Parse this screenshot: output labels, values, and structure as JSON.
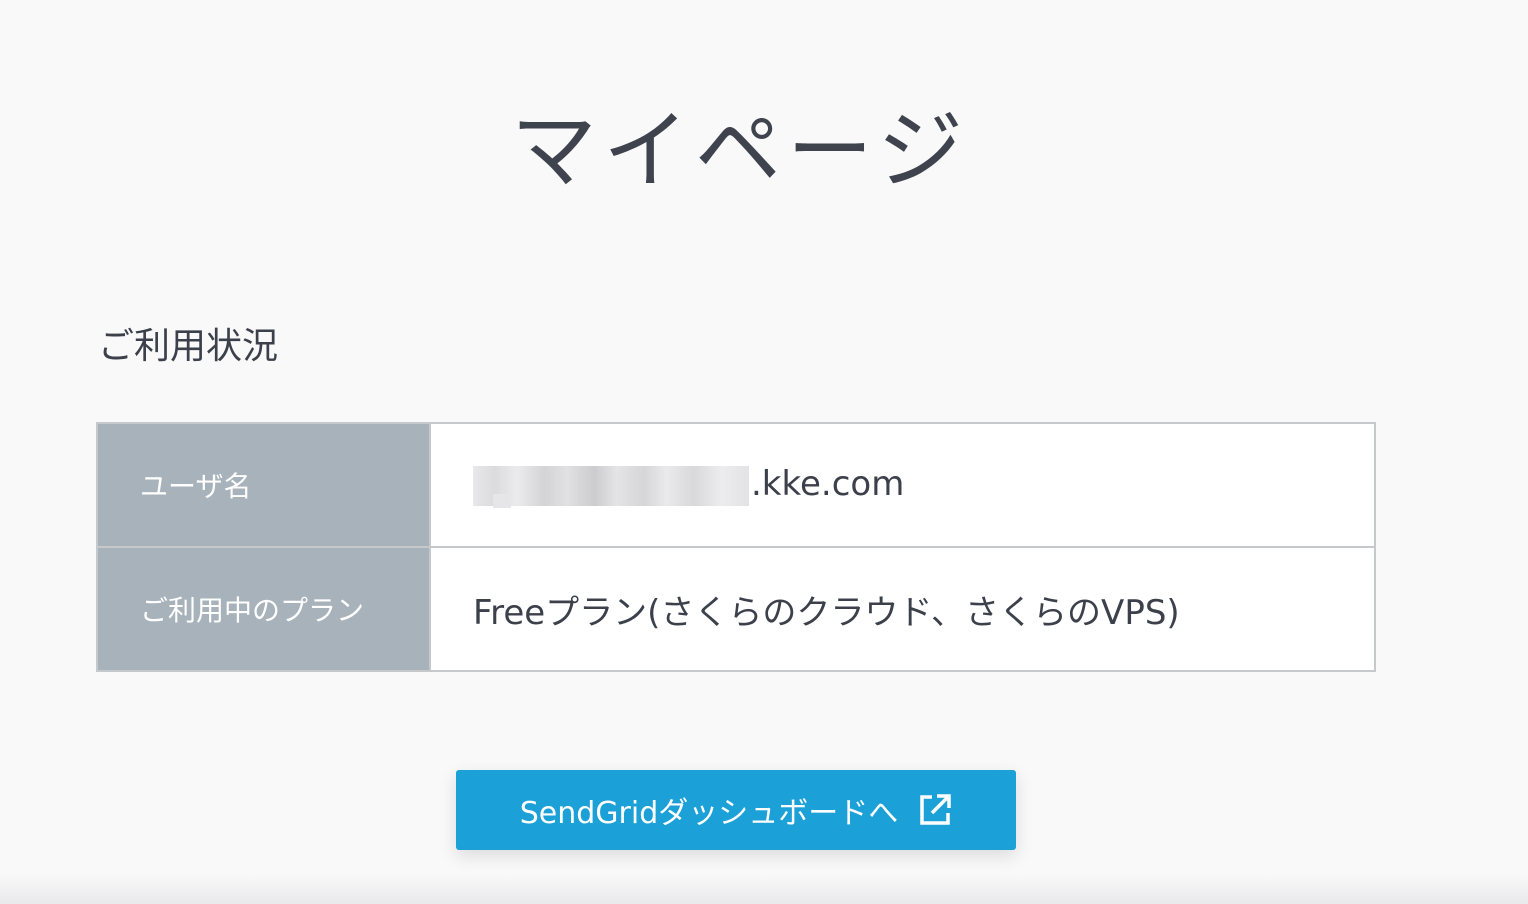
{
  "page": {
    "title": "マイページ"
  },
  "usage": {
    "section_title": "ご利用状況",
    "rows": [
      {
        "label": "ユーザ名",
        "value": ".kke.com"
      },
      {
        "label": "ご利用中のプラン",
        "value": "Freeプラン(さくらのクラウド、さくらのVPS)"
      }
    ]
  },
  "actions": {
    "dashboard_button_label": "SendGridダッシュボードへ",
    "dashboard_button_icon": "external-link-icon"
  },
  "colors": {
    "background": "#f9f9fa",
    "label_cell": "#a7b2bb",
    "button": "#1ba0d7",
    "text": "#3c404b"
  }
}
